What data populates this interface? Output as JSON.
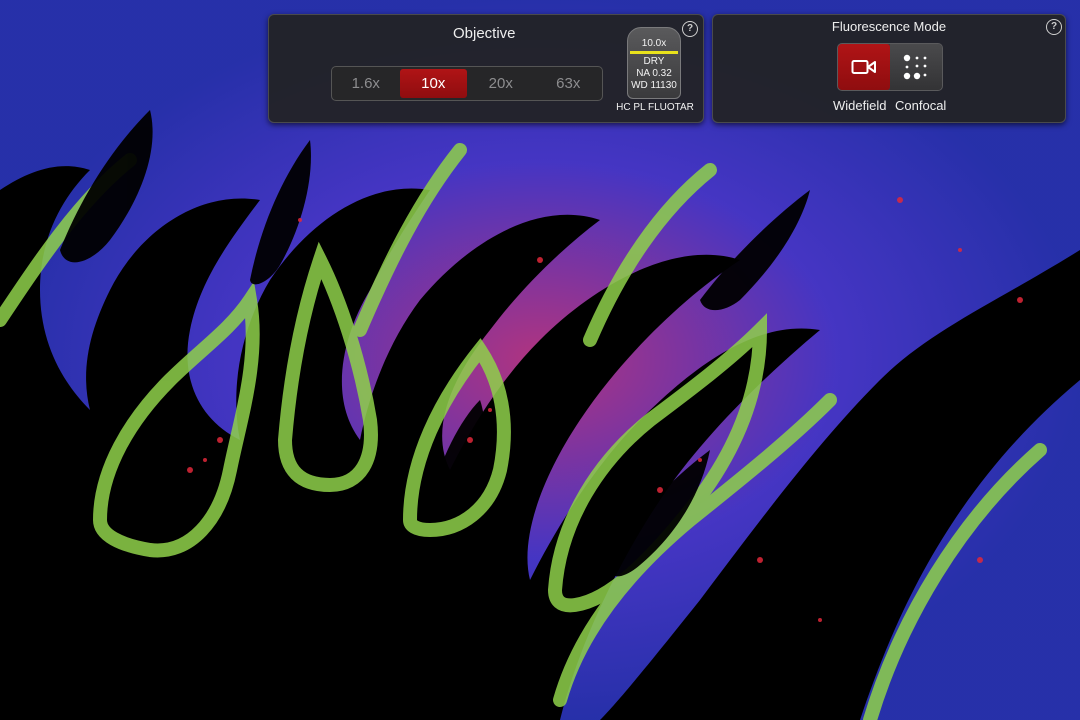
{
  "objective": {
    "title": "Objective",
    "help": "?",
    "magnifications": [
      {
        "label": "1.6x",
        "active": false
      },
      {
        "label": "10x",
        "active": true
      },
      {
        "label": "20x",
        "active": false
      },
      {
        "label": "63x",
        "active": false
      }
    ],
    "lens": {
      "magnification": "10.0x",
      "type": "DRY",
      "na": "NA 0.32",
      "wd": "WD 11130",
      "name": "HC PL FLUOTAR"
    }
  },
  "fluorescence": {
    "title": "Fluorescence Mode",
    "help": "?",
    "modes": [
      {
        "label": "Widefield",
        "icon": "camera-icon",
        "active": true
      },
      {
        "label": "Confocal",
        "icon": "pinhole-dots-icon",
        "active": false
      }
    ]
  },
  "colors": {
    "accent_red": "#a01012",
    "panel_bg": "#222224",
    "lens_stripe": "#e9e21c",
    "stain_green": "#8fd14a",
    "stain_blue": "#3a4ad8",
    "stain_red": "#d8283a"
  }
}
